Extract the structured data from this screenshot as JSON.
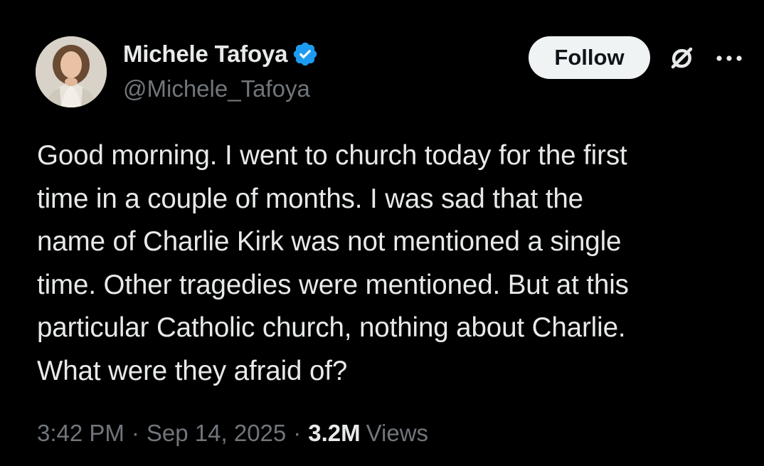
{
  "author": {
    "display_name": "Michele Tafoya",
    "handle": "@Michele_Tafoya",
    "verified": true,
    "avatar_icon": "profile-photo"
  },
  "actions": {
    "follow_label": "Follow",
    "grok_icon": "grok-icon",
    "more_icon": "more-horizontal-icon"
  },
  "tweet": {
    "text": "Good morning.  I went to church today for the first\ntime in a couple of months.  I was sad that the\nname of Charlie Kirk was not mentioned a single\ntime.  Other tragedies were mentioned. But at this\nparticular Catholic church, nothing about Charlie.\nWhat were they afraid of?"
  },
  "meta": {
    "time": "3:42 PM",
    "separator": "·",
    "date": "Sep 14, 2025",
    "views_count": "3.2M",
    "views_label": "Views"
  },
  "colors": {
    "background": "#000000",
    "primary_text": "#e7e9ea",
    "secondary_text": "#71767b",
    "verified_blue": "#1d9bf0",
    "follow_bg": "#eff3f4"
  }
}
